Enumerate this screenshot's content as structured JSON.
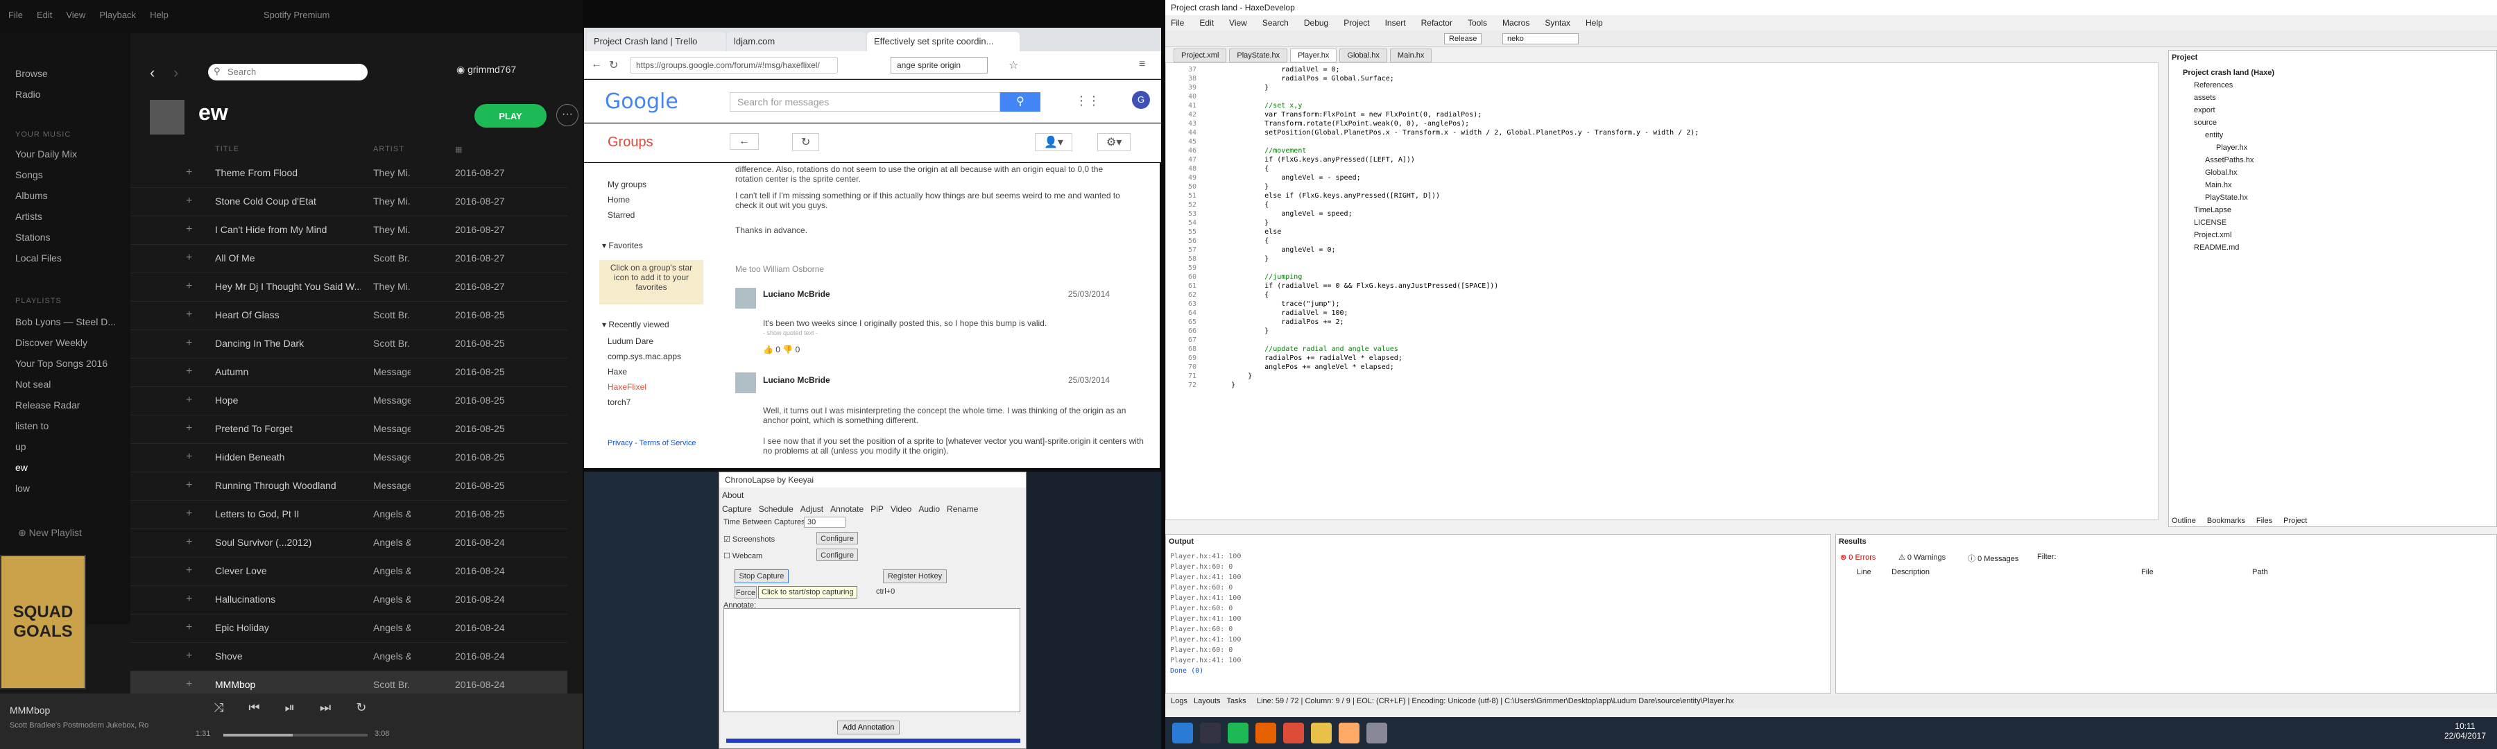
{
  "spotify": {
    "app_title": "Spotify Premium",
    "menu": [
      "File",
      "Edit",
      "View",
      "Playback",
      "Help"
    ],
    "nav": [
      "Browse",
      "Radio"
    ],
    "library_header": "YOUR MUSIC",
    "library": [
      "Your Daily Mix",
      "Songs",
      "Albums",
      "Artists",
      "Stations",
      "Local Files"
    ],
    "playlists_header": "PLAYLISTS",
    "playlists": [
      "Bob Lyons — Steel D...",
      "Discover Weekly",
      "Your Top Songs 2016",
      "Not seal",
      "Release Radar",
      "listen to",
      "up",
      "ew",
      "low"
    ],
    "new_playlist": "New Playlist",
    "cover_text": "SQUAD GOALS",
    "search_placeholder": "Search",
    "username": "grimmd767",
    "playlist_title": "ew",
    "play_label": "PLAY",
    "columns": {
      "title": "TITLE",
      "artist": "ARTIST"
    },
    "tracks": [
      {
        "title": "Theme From Flood",
        "artist": "They Mi...",
        "date": "2016-08-27"
      },
      {
        "title": "Stone Cold Coup d'Etat",
        "artist": "They Mi...",
        "date": "2016-08-27"
      },
      {
        "title": "I Can't Hide from My Mind",
        "artist": "They Mi...",
        "date": "2016-08-27"
      },
      {
        "title": "All Of Me",
        "artist": "Scott Br...",
        "date": "2016-08-27"
      },
      {
        "title": "Hey Mr Dj I Thought You Said W...",
        "artist": "They Mi...",
        "date": "2016-08-27"
      },
      {
        "title": "Heart Of Glass",
        "artist": "Scott Br...",
        "date": "2016-08-25"
      },
      {
        "title": "Dancing In The Dark",
        "artist": "Scott Br...",
        "date": "2016-08-25"
      },
      {
        "title": "Autumn",
        "artist": "Message...",
        "date": "2016-08-25"
      },
      {
        "title": "Hope",
        "artist": "Message...",
        "date": "2016-08-25"
      },
      {
        "title": "Pretend To Forget",
        "artist": "Message...",
        "date": "2016-08-25"
      },
      {
        "title": "Hidden Beneath",
        "artist": "Message...",
        "date": "2016-08-25"
      },
      {
        "title": "Running Through Woodland",
        "artist": "Message...",
        "date": "2016-08-25"
      },
      {
        "title": "Letters to God, Pt II",
        "artist": "Angels &...",
        "date": "2016-08-25"
      },
      {
        "title": "Soul Survivor (...2012)",
        "artist": "Angels &...",
        "date": "2016-08-24"
      },
      {
        "title": "Clever Love",
        "artist": "Angels &...",
        "date": "2016-08-24"
      },
      {
        "title": "Hallucinations",
        "artist": "Angels &...",
        "date": "2016-08-24"
      },
      {
        "title": "Epic Holiday",
        "artist": "Angels &...",
        "date": "2016-08-24"
      },
      {
        "title": "Shove",
        "artist": "Angels &...",
        "date": "2016-08-24"
      },
      {
        "title": "MMMbop",
        "artist": "Scott Br...",
        "date": "2016-08-24"
      }
    ],
    "now_playing": {
      "title": "MMMbop",
      "subtitle": "Scott Bradlee's Postmodern Jukebox, Ro",
      "elapsed": "1:31",
      "total": "3:08",
      "progress": 0.48
    }
  },
  "chrome": {
    "tabs": [
      "Project Crash land | Trello",
      "ldjam.com",
      "Effectively set sprite coordin..."
    ],
    "url": "https://groups.google.com/forum/#!msg/haxeflixel/",
    "find_text": "ange sprite origin",
    "search_placeholder": "Search for messages",
    "groups_label": "Groups",
    "sidebar": {
      "my_groups": "My groups",
      "home": "Home",
      "starred": "Starred",
      "favorites": "Favorites",
      "fav_hint": "Click on a group's star icon to add it to your favorites",
      "recent": "Recently viewed",
      "recent_items": [
        "Ludum Dare",
        "comp.sys.mac.apps",
        "Haxe",
        "HaxeFlixel",
        "torch7"
      ],
      "footer": "Privacy - Terms of Service"
    },
    "post_top": "difference. Also, rotations do not seem to use the origin at all because with an origin equal to 0,0 the rotation center is the sprite center.",
    "post_p2": "I can't tell if I'm missing something or if this actually how things are but seems weird to me and wanted to check it out wit you guys.",
    "post_thanks": "Thanks in advance.",
    "me_too": "Me too William Osborne",
    "replies": [
      {
        "name": "Luciano McBride",
        "date": "25/03/2014",
        "text": "It's been two weeks since I originally posted this, so I hope this bump is valid.",
        "quoted": "- show quoted text -"
      },
      {
        "name": "Luciano McBride",
        "date": "25/03/2014",
        "text": "Well, it turns out I was misinterpreting the concept the whole time. I was thinking of the origin as an anchor point, which is something different.",
        "text2": "I see now that if you set the position of a sprite to [whatever vector you want]-sprite.origin it centers with no problems at all (unless you modify it the origin)."
      }
    ],
    "votes": [
      "0",
      "0"
    ]
  },
  "chronolapse": {
    "title": "ChronoLapse by Keeyai",
    "about": "About",
    "tabs": [
      "Capture",
      "Schedule",
      "Adjust",
      "Annotate",
      "PiP",
      "Video",
      "Audio",
      "Rename"
    ],
    "time_between": "Time Between Captures:",
    "interval": "30",
    "screenshots": "Screenshots",
    "webcam": "Webcam",
    "configure": "Configure",
    "stop": "Stop Capture",
    "register": "Register Hotkey",
    "force": "Force",
    "tooltip": "Click to start/stop capturing",
    "hotkey": "ctrl+0",
    "annotate": "Annotate:",
    "add_annotation": "Add Annotation"
  },
  "haxedevelop": {
    "title": "Project crash land - HaxeDevelop",
    "menu": [
      "File",
      "Edit",
      "View",
      "Search",
      "Debug",
      "Project",
      "Insert",
      "Refactor",
      "Tools",
      "Macros",
      "Syntax",
      "Help"
    ],
    "config": "Release",
    "target": "neko",
    "file_tabs": [
      "Project.xml",
      "PlayState.hx",
      "Player.hx",
      "Global.hx",
      "Main.hx"
    ],
    "active_tab": "Player.hx",
    "code": [
      {
        "n": "37",
        "t": "            radialVel = 0;"
      },
      {
        "n": "38",
        "t": "            radialPos = Global.Surface;"
      },
      {
        "n": "39",
        "t": "        }"
      },
      {
        "n": "40",
        "t": ""
      },
      {
        "n": "41",
        "t": "        //set x,y"
      },
      {
        "n": "42",
        "t": "        var Transform:FlxPoint = new FlxPoint(0, radialPos);"
      },
      {
        "n": "43",
        "t": "        Transform.rotate(FlxPoint.weak(0, 0), -anglePos);"
      },
      {
        "n": "44",
        "t": "        setPosition(Global.PlanetPos.x - Transform.x - width / 2, Global.PlanetPos.y - Transform.y - width / 2);"
      },
      {
        "n": "45",
        "t": ""
      },
      {
        "n": "46",
        "t": "        //movement"
      },
      {
        "n": "47",
        "t": "        if (FlxG.keys.anyPressed([LEFT, A]))"
      },
      {
        "n": "48",
        "t": "        {"
      },
      {
        "n": "49",
        "t": "            angleVel = - speed;"
      },
      {
        "n": "50",
        "t": "        }"
      },
      {
        "n": "51",
        "t": "        else if (FlxG.keys.anyPressed([RIGHT, D]))"
      },
      {
        "n": "52",
        "t": "        {"
      },
      {
        "n": "53",
        "t": "            angleVel = speed;"
      },
      {
        "n": "54",
        "t": "        }"
      },
      {
        "n": "55",
        "t": "        else"
      },
      {
        "n": "56",
        "t": "        {"
      },
      {
        "n": "57",
        "t": "            angleVel = 0;"
      },
      {
        "n": "58",
        "t": "        }"
      },
      {
        "n": "59",
        "t": ""
      },
      {
        "n": "60",
        "t": "        //jumping"
      },
      {
        "n": "61",
        "t": "        if (radialVel == 0 && FlxG.keys.anyJustPressed([SPACE]))"
      },
      {
        "n": "62",
        "t": "        {"
      },
      {
        "n": "63",
        "t": "            trace(\"jump\");"
      },
      {
        "n": "64",
        "t": "            radialVel = 100;"
      },
      {
        "n": "65",
        "t": "            radialPos += 2;"
      },
      {
        "n": "66",
        "t": "        }"
      },
      {
        "n": "67",
        "t": ""
      },
      {
        "n": "68",
        "t": "        //update radial and angle values"
      },
      {
        "n": "69",
        "t": "        radialPos += radialVel * elapsed;"
      },
      {
        "n": "70",
        "t": "        anglePos += angleVel * elapsed;"
      },
      {
        "n": "71",
        "t": "    }"
      },
      {
        "n": "72",
        "t": "}"
      }
    ],
    "project_header": "Project",
    "project_tree": [
      "Project crash land (Haxe)",
      "References",
      "assets",
      "export",
      "source",
      "entity",
      "Player.hx",
      "AssetPaths.hx",
      "Global.hx",
      "Main.hx",
      "PlayState.hx",
      "TimeLapse",
      "LICENSE",
      "Project.xml",
      "README.md"
    ],
    "project_tabs": [
      "Outline",
      "Bookmarks",
      "Files",
      "Project"
    ],
    "output_header": "Output",
    "output_lines": [
      "Player.hx:41: 100",
      "Player.hx:60: 0",
      "Player.hx:41: 100",
      "Player.hx:60: 0",
      "Player.hx:41: 100",
      "Player.hx:60: 0",
      "Player.hx:41: 100",
      "Player.hx:60: 0",
      "Player.hx:41: 100",
      "Player.hx:60: 0",
      "Player.hx:41: 100",
      "Done (0)"
    ],
    "results_header": "Results",
    "errors": "0 Errors",
    "warnings": "0 Warnings",
    "messages": "0 Messages",
    "filter": "Filter:",
    "res_cols": [
      "Line",
      "Description",
      "File",
      "Path"
    ],
    "bottom_tabs": [
      "Logs",
      "Layouts",
      "Tasks"
    ],
    "status": "Line: 59 / 72  |  Column: 9 / 9  |  EOL: (CR+LF)  |  Encoding: Unicode (utf-8)  |  C:\\Users\\Grimmer\\Desktop\\app\\Ludum Dare\\source\\entity\\Player.hx"
  },
  "taskbar": {
    "time": "10:11",
    "date": "22/04/2017"
  }
}
